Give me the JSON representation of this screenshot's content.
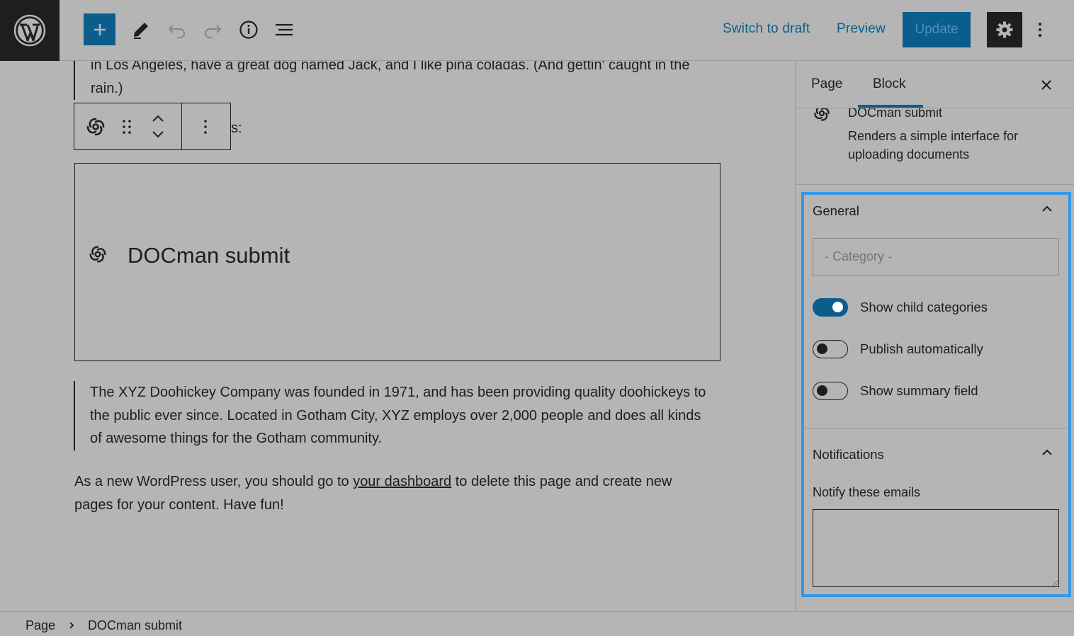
{
  "toolbar": {
    "wordpress_logo": "wordpress-logo-icon",
    "add_block": "plus-icon",
    "tools": "pencil-icon",
    "undo": "undo-icon",
    "redo": "redo-icon",
    "details": "info-icon",
    "list_view": "list-view-icon",
    "switch_to_draft": "Switch to draft",
    "preview": "Preview",
    "update": "Update",
    "settings": "gear-icon",
    "options": "vertical-ellipsis-icon"
  },
  "editor": {
    "quote_top": "in Los Angeles, have a great dog named Jack, and I like piña coladas. (And gettin' caught in the rain.)",
    "partial_text": "s:",
    "docman_block_title": "DOCman submit",
    "quote": "The XYZ Doohickey Company was founded in 1971, and has been providing quality doohickeys to the public ever since. Located in Gotham City, XYZ employs over 2,000 people and does all kinds of awesome things for the Gotham community.",
    "paragraph_before": "As a new WordPress user, you should go to ",
    "paragraph_link": "your dashboard",
    "paragraph_after": " to delete this page and create new pages for your content. Have fun!"
  },
  "sidebar": {
    "tabs": [
      {
        "label": "Page",
        "active": false
      },
      {
        "label": "Block",
        "active": true
      }
    ],
    "block_card": {
      "name": "DOCman submit",
      "description": "Renders a simple interface for uploading documents"
    },
    "general": {
      "title": "General",
      "category_placeholder": "- Category -",
      "toggles": [
        {
          "label": "Show child categories",
          "on": true
        },
        {
          "label": "Publish automatically",
          "on": false
        },
        {
          "label": "Show summary field",
          "on": false
        }
      ]
    },
    "notifications": {
      "title": "Notifications",
      "notify_label": "Notify these emails",
      "notify_value": ""
    }
  },
  "breadcrumb": [
    "Page",
    "DOCman submit"
  ],
  "colors": {
    "accent": "#0b5e8c",
    "focus": "#3497e6",
    "background": "#b5b5b5",
    "dark": "#1e1e1e"
  }
}
